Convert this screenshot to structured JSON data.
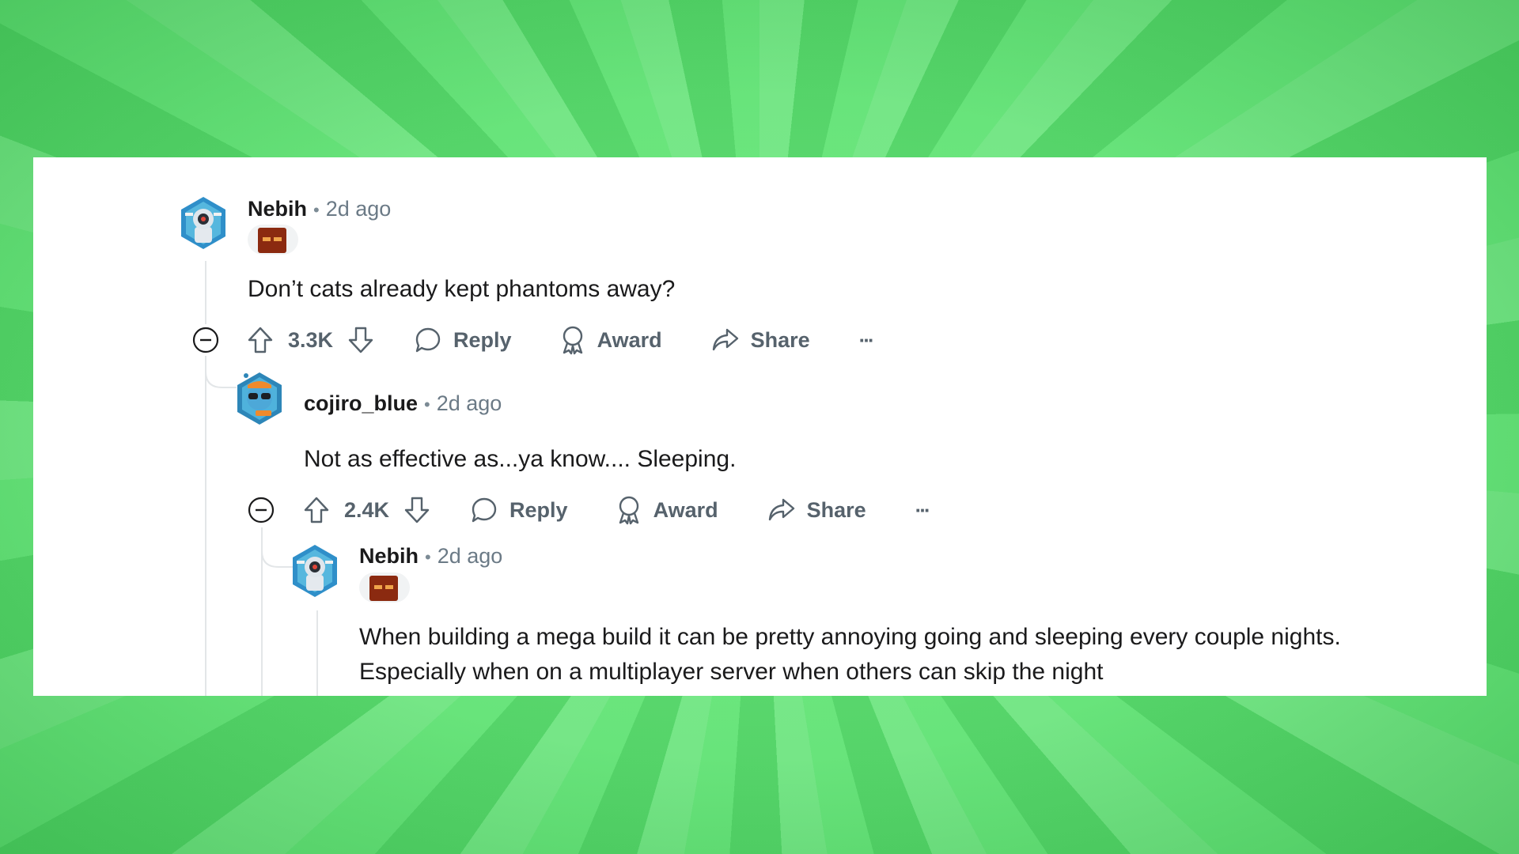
{
  "comments": [
    {
      "username": "Nebih",
      "time": "2d ago",
      "text": "Don’t cats already kept phantoms away?",
      "votes": "3.3K",
      "reply_label": "Reply",
      "award_label": "Award",
      "share_label": "Share",
      "more_label": "···"
    },
    {
      "username": "cojiro_blue",
      "time": "2d ago",
      "text": "Not as effective as...ya know.... Sleeping.",
      "votes": "2.4K",
      "reply_label": "Reply",
      "award_label": "Award",
      "share_label": "Share",
      "more_label": "···"
    },
    {
      "username": "Nebih",
      "time": "2d ago",
      "text_lines": [
        "When building a mega build it can be pretty annoying going and sleeping every couple nights.",
        "Especially when on a multiplayer server when others can skip the night"
      ]
    }
  ],
  "colors": {
    "background": "#5fe273",
    "panel": "#ffffff",
    "text": "#1a1a1b",
    "muted": "#56626c"
  },
  "icons": [
    "collapse-icon",
    "upvote-icon",
    "downvote-icon",
    "reply-icon",
    "award-icon",
    "share-icon",
    "more-icon"
  ]
}
